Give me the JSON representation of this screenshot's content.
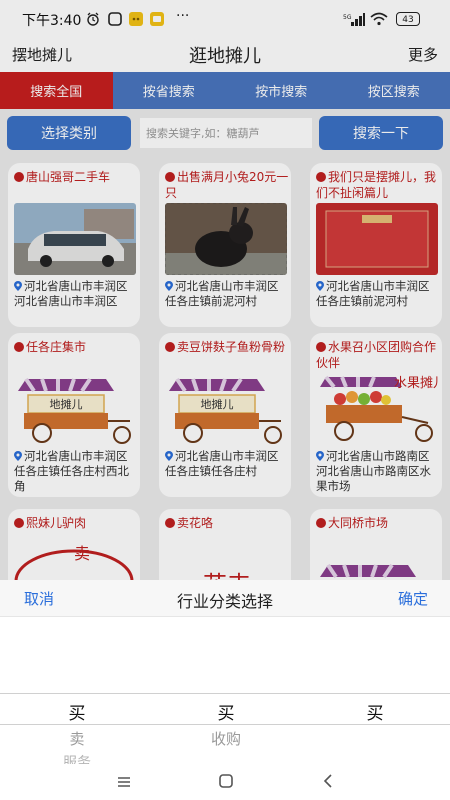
{
  "status": {
    "time": "下午3:40",
    "battery": "43",
    "signal": "5G"
  },
  "header": {
    "left": "摆地摊儿",
    "title": "逛地摊儿",
    "right": "更多"
  },
  "tabs": [
    {
      "label": "搜索全国",
      "active": true
    },
    {
      "label": "按省搜索",
      "active": false
    },
    {
      "label": "按市搜索",
      "active": false
    },
    {
      "label": "按区搜索",
      "active": false
    }
  ],
  "search": {
    "category_label": "选择类别",
    "placeholder": "搜索关键字,如：糖葫芦",
    "submit_label": "搜索一下"
  },
  "cards": [
    {
      "title": "唐山强哥二手车",
      "location": "河北省唐山市丰润区河北省唐山市丰润区",
      "image": "car-photo"
    },
    {
      "title": "出售满月小兔20元一只",
      "location": "河北省唐山市丰润区任各庄镇前泥河村",
      "image": "rabbit-photo"
    },
    {
      "title": "我们只是摆摊儿，我们不扯闲篇儿",
      "location": "河北省唐山市丰润区任各庄镇前泥河村",
      "image": "red-banner-photo"
    },
    {
      "title": "任各庄集市",
      "location": "河北省唐山市丰润区任各庄镇任各庄村西北角",
      "image": "cart",
      "cart_sign": "地摊儿"
    },
    {
      "title": "卖豆饼麸子鱼粉骨粉",
      "location": "河北省唐山市丰润区任各庄镇任各庄村",
      "image": "cart",
      "cart_sign": "地摊儿"
    },
    {
      "title": "水果召小区团购合作伙伴",
      "location": "河北省唐山市路南区河北省唐山市路南区水果市场",
      "image": "fruit-cart",
      "cart_sign": "水果摊儿"
    },
    {
      "title": "熙妹儿驴肉",
      "location": "",
      "image": "plate",
      "cart_sign": "卖"
    },
    {
      "title": "卖花咯",
      "location": "",
      "image": "flower",
      "cart_sign": "花卉"
    },
    {
      "title": "大同桥市场",
      "location": "",
      "image": "cart-top"
    }
  ],
  "picker": {
    "cancel": "取消",
    "title": "行业分类选择",
    "confirm": "确定",
    "columns": [
      {
        "selected": "买",
        "below": [
          "卖",
          "服务"
        ]
      },
      {
        "selected": "买",
        "below": [
          "收购"
        ]
      },
      {
        "selected": "买",
        "below": []
      }
    ]
  },
  "colors": {
    "tab_active": "#c71f1f",
    "tab": "#4a76bf",
    "button": "#3b71c6",
    "title_red": "#c02020",
    "link_blue": "#2a6edb"
  },
  "navbar": {
    "icons": [
      "menu-icon",
      "home-icon",
      "back-icon"
    ]
  }
}
